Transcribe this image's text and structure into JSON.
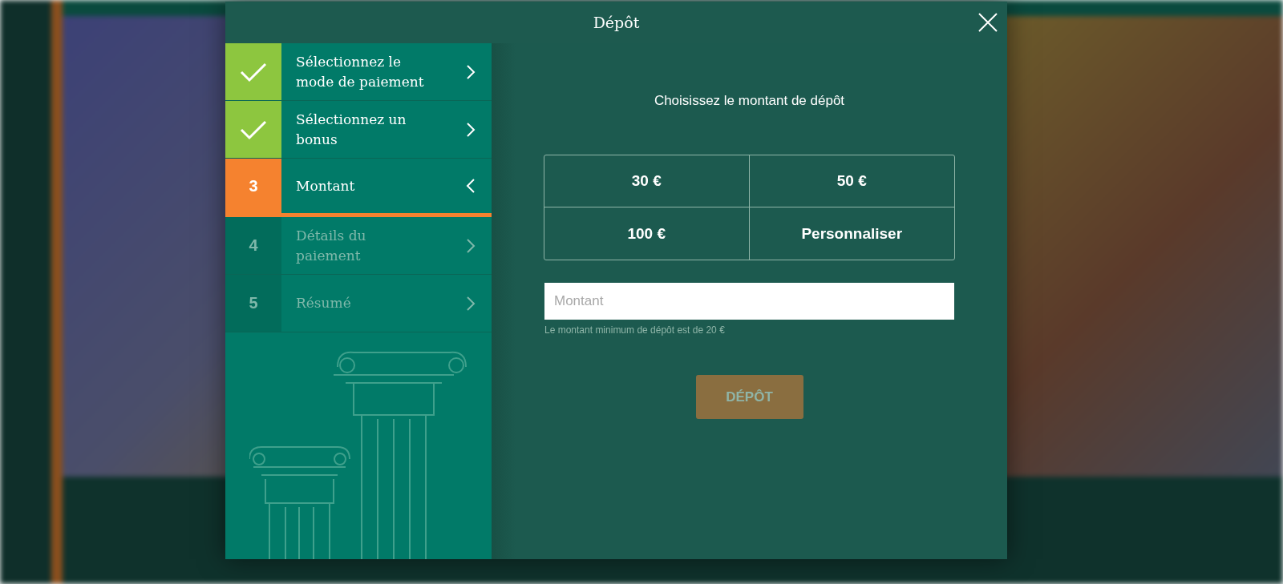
{
  "dialog": {
    "title": "Dépôt"
  },
  "steps": [
    {
      "label": "Sélectionnez le mode de paiement",
      "kind": "done"
    },
    {
      "label": "Sélectionnez un bonus",
      "kind": "done"
    },
    {
      "number": "3",
      "label": "Montant",
      "kind": "current"
    },
    {
      "number": "4",
      "label": "Détails du paiement",
      "kind": "pending"
    },
    {
      "number": "5",
      "label": "Résumé",
      "kind": "pending"
    }
  ],
  "heading": "Choisissez le montant de dépôt",
  "amounts": [
    {
      "label": "30 €",
      "selected": false
    },
    {
      "label": "50 €",
      "selected": false
    },
    {
      "label": "100 €",
      "selected": false
    },
    {
      "label": "Personnaliser",
      "selected": false
    }
  ],
  "amount_field": {
    "placeholder": "Montant"
  },
  "hint": "Le montant minimum de dépôt est de 20 €",
  "submit": {
    "label": "DÉPÔT",
    "disabled": true
  }
}
